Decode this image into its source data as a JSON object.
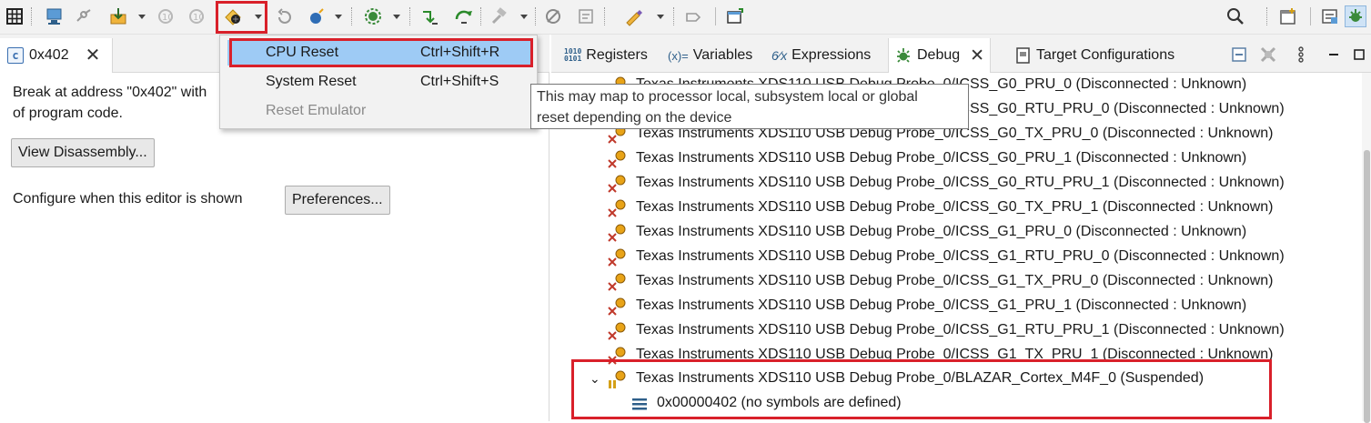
{
  "toolbar": {
    "buttons": [
      "grid-icon",
      "debug-launch-icon",
      "connect-icon",
      "load-program-icon",
      "chip-a-icon",
      "chip-b-icon",
      "reset-icon",
      "restart-icon",
      "run-icon",
      "gear-run-icon",
      "step-into-icon",
      "step-over-icon",
      "hammer-icon",
      "breakpoint-icon",
      "expressions-icon",
      "pencil-icon",
      "step-return-icon",
      "new-window-icon",
      "search-icon",
      "perspective-icon",
      "ccs-edit-icon",
      "debug-perspective-icon"
    ]
  },
  "editor": {
    "tab_label": "0x402",
    "tab_icon": "c-file-icon",
    "message_line1": "Break at address \"0x402\" with",
    "message_line2": "of program code.",
    "view_disassembly_label": "View Disassembly...",
    "configure_label": "Configure when this editor is shown",
    "preferences_label": "Preferences..."
  },
  "view_tabs": [
    {
      "label": "Registers",
      "icon": "registers-icon"
    },
    {
      "label": "Variables",
      "icon": "variables-icon"
    },
    {
      "label": "Expressions",
      "icon": "expressions-icon"
    },
    {
      "label": "Debug",
      "icon": "debug-icon"
    },
    {
      "label": "Target Configurations",
      "icon": "target-config-icon"
    }
  ],
  "menu": {
    "items": [
      {
        "label": "CPU Reset",
        "shortcut": "Ctrl+Shift+R",
        "state": "selected"
      },
      {
        "label": "System Reset",
        "shortcut": "Ctrl+Shift+S",
        "state": "normal"
      },
      {
        "label": "Reset Emulator",
        "shortcut": "",
        "state": "disabled"
      }
    ]
  },
  "tooltip": {
    "line1": "This may map to processor local, subsystem local or global",
    "line2": "reset depending on the device"
  },
  "debug_tree": {
    "partial_rows": [
      "Texas Instruments XDS110 USB Debug Probe_0/ICSS_G0_PRU_0 (Disconnected : Unknown)",
      "Texas Instruments XDS110 USB Debug Probe_0/ICSS_G0_RTU_PRU_0 (Disconnected : Unknown)"
    ],
    "rows": [
      "Texas Instruments XDS110 USB Debug Probe_0/ICSS_G0_TX_PRU_0 (Disconnected : Unknown)",
      "Texas Instruments XDS110 USB Debug Probe_0/ICSS_G0_PRU_1 (Disconnected : Unknown)",
      "Texas Instruments XDS110 USB Debug Probe_0/ICSS_G0_RTU_PRU_1 (Disconnected : Unknown)",
      "Texas Instruments XDS110 USB Debug Probe_0/ICSS_G0_TX_PRU_1 (Disconnected : Unknown)",
      "Texas Instruments XDS110 USB Debug Probe_0/ICSS_G1_PRU_0 (Disconnected : Unknown)",
      "Texas Instruments XDS110 USB Debug Probe_0/ICSS_G1_RTU_PRU_0 (Disconnected : Unknown)",
      "Texas Instruments XDS110 USB Debug Probe_0/ICSS_G1_TX_PRU_0 (Disconnected : Unknown)",
      "Texas Instruments XDS110 USB Debug Probe_0/ICSS_G1_PRU_1 (Disconnected : Unknown)",
      "Texas Instruments XDS110 USB Debug Probe_0/ICSS_G1_RTU_PRU_1 (Disconnected : Unknown)",
      "Texas Instruments XDS110 USB Debug Probe_0/ICSS_G1_TX_PRU_1 (Disconnected : Unknown)"
    ],
    "suspended_row": "Texas Instruments XDS110 USB Debug Probe_0/BLAZAR_Cortex_M4F_0 (Suspended)",
    "frame_row": "0x00000402  (no symbols are defined)"
  },
  "colors": {
    "highlight_box": "#d9202a",
    "menu_selection": "#9ecbf5",
    "toolbar_bg": "#f2f2f2"
  }
}
